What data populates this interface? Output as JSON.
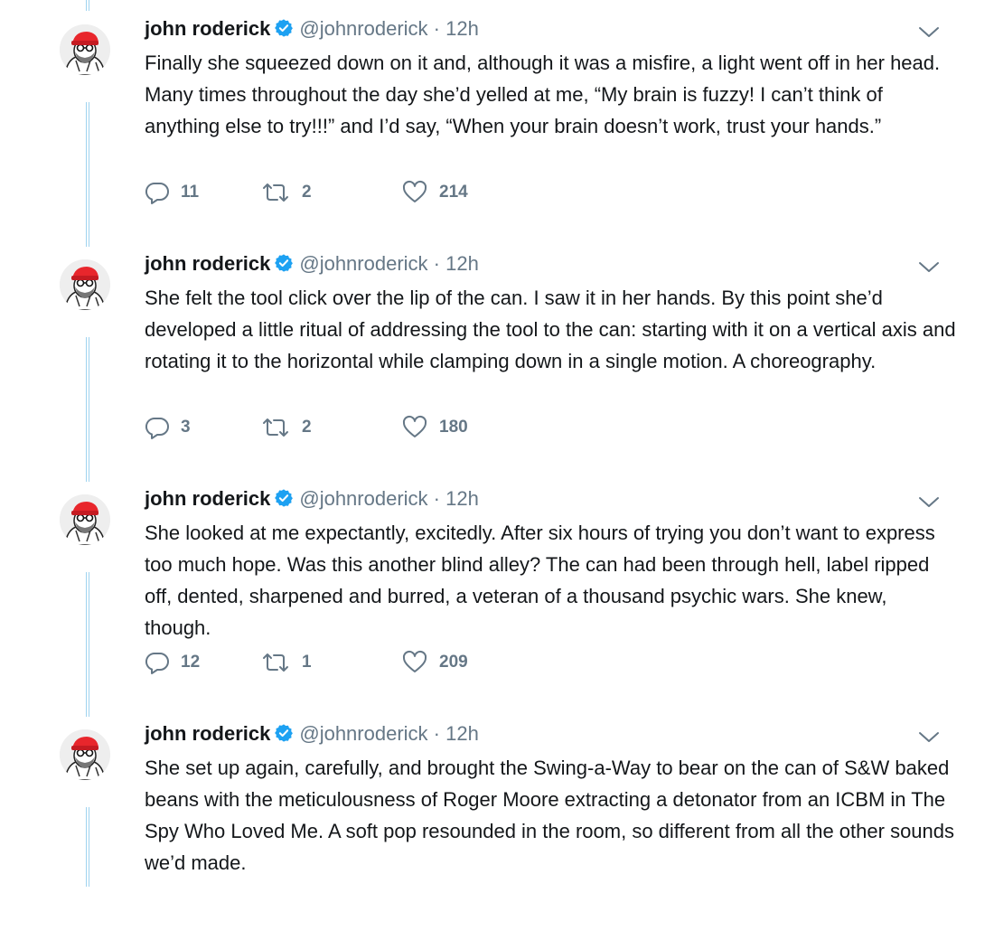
{
  "tweets": [
    {
      "name": "john roderick",
      "handle": "@johnroderick",
      "sep": "·",
      "time": "12h",
      "text": "Finally she squeezed down on it and, although it was a misfire, a light went off in her head. Many times throughout the day she’d yelled at me, “My brain is fuzzy! I can’t think of anything else to try!!!” and I’d say, “When your brain doesn’t work, trust your hands.”",
      "replies": "11",
      "retweets": "2",
      "likes": "214"
    },
    {
      "name": "john roderick",
      "handle": "@johnroderick",
      "sep": "·",
      "time": "12h",
      "text": "She felt the tool click over the lip of the can. I saw it in her hands. By this point she’d developed a little ritual of addressing the tool to the can: starting with it on a vertical axis and rotating it to the horizontal while clamping down in a single motion. A choreography.",
      "replies": "3",
      "retweets": "2",
      "likes": "180"
    },
    {
      "name": "john roderick",
      "handle": "@johnroderick",
      "sep": "·",
      "time": "12h",
      "text": "She looked at me expectantly, excitedly. After six hours of trying you don’t want to express too much hope. Was this another blind alley? The can had been through hell, label ripped off, dented, sharpened and burred, a veteran of a thousand psychic wars. She knew, though.",
      "replies": "12",
      "retweets": "1",
      "likes": "209"
    },
    {
      "name": "john roderick",
      "handle": "@johnroderick",
      "sep": "·",
      "time": "12h",
      "text": "She set up again, carefully, and brought the Swing-a-Way to bear on the can of S&W baked beans with the meticulousness of Roger Moore extracting a detonator from an ICBM in The Spy Who Loved Me. A soft pop resounded in the room, so different from all the other sounds we’d made.",
      "replies": "",
      "retweets": "",
      "likes": ""
    }
  ],
  "colors": {
    "name": "#14171a",
    "secondary": "#657786",
    "verified": "#1da1f2",
    "thread_line": "#9fd3ef"
  },
  "icons": [
    "avatar",
    "verified-badge-icon",
    "chevron-down-icon",
    "reply-icon",
    "retweet-icon",
    "like-icon"
  ]
}
